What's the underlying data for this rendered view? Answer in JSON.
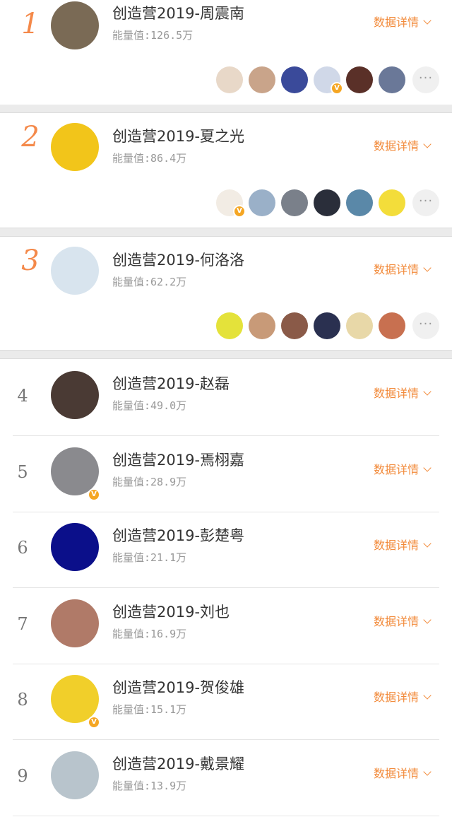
{
  "ranking": [
    {
      "rank": "1",
      "name": "创造营2019-周震南",
      "energy_label": "能量值:",
      "energy": "126.5万",
      "detail": "数据详情",
      "verified": false,
      "avatar_bg": "#7a6a55",
      "fans": [
        "#e8d8c8",
        "#c9a48a",
        "#3a4a9a",
        "#d0d8e8",
        "#5a3028",
        "#6a7898"
      ],
      "fan_verified_index": 3
    },
    {
      "rank": "2",
      "name": "创造营2019-夏之光",
      "energy_label": "能量值:",
      "energy": "86.4万",
      "detail": "数据详情",
      "verified": false,
      "avatar_bg": "#f2c51a",
      "fans": [
        "#f2ece4",
        "#9ab0c8",
        "#7a808a",
        "#2a2e3a",
        "#5a88a8",
        "#f3dd3a"
      ],
      "fan_verified_index": 0
    },
    {
      "rank": "3",
      "name": "创造营2019-何洛洛",
      "energy_label": "能量值:",
      "energy": "62.2万",
      "detail": "数据详情",
      "verified": false,
      "avatar_bg": "#d8e4ee",
      "fans": [
        "#e4e23a",
        "#c89a78",
        "#8a5a48",
        "#2a3050",
        "#e8d8a8",
        "#c87050"
      ],
      "fan_verified_index": -1
    },
    {
      "rank": "4",
      "name": "创造营2019-赵磊",
      "energy_label": "能量值:",
      "energy": "49.0万",
      "detail": "数据详情",
      "verified": false,
      "avatar_bg": "#4a3a34"
    },
    {
      "rank": "5",
      "name": "创造营2019-焉栩嘉",
      "energy_label": "能量值:",
      "energy": "28.9万",
      "detail": "数据详情",
      "verified": true,
      "avatar_bg": "#8a8a8e"
    },
    {
      "rank": "6",
      "name": "创造营2019-彭楚粤",
      "energy_label": "能量值:",
      "energy": "21.1万",
      "detail": "数据详情",
      "verified": false,
      "avatar_bg": "#0b0f8a"
    },
    {
      "rank": "7",
      "name": "创造营2019-刘也",
      "energy_label": "能量值:",
      "energy": "16.9万",
      "detail": "数据详情",
      "verified": false,
      "avatar_bg": "#b07a68"
    },
    {
      "rank": "8",
      "name": "创造营2019-贺俊雄",
      "energy_label": "能量值:",
      "energy": "15.1万",
      "detail": "数据详情",
      "verified": true,
      "avatar_bg": "#f1cf2a"
    },
    {
      "rank": "9",
      "name": "创造营2019-戴景耀",
      "energy_label": "能量值:",
      "energy": "13.9万",
      "detail": "数据详情",
      "verified": false,
      "avatar_bg": "#b8c4cc"
    }
  ],
  "more_label": "···",
  "verified_mark": "V"
}
